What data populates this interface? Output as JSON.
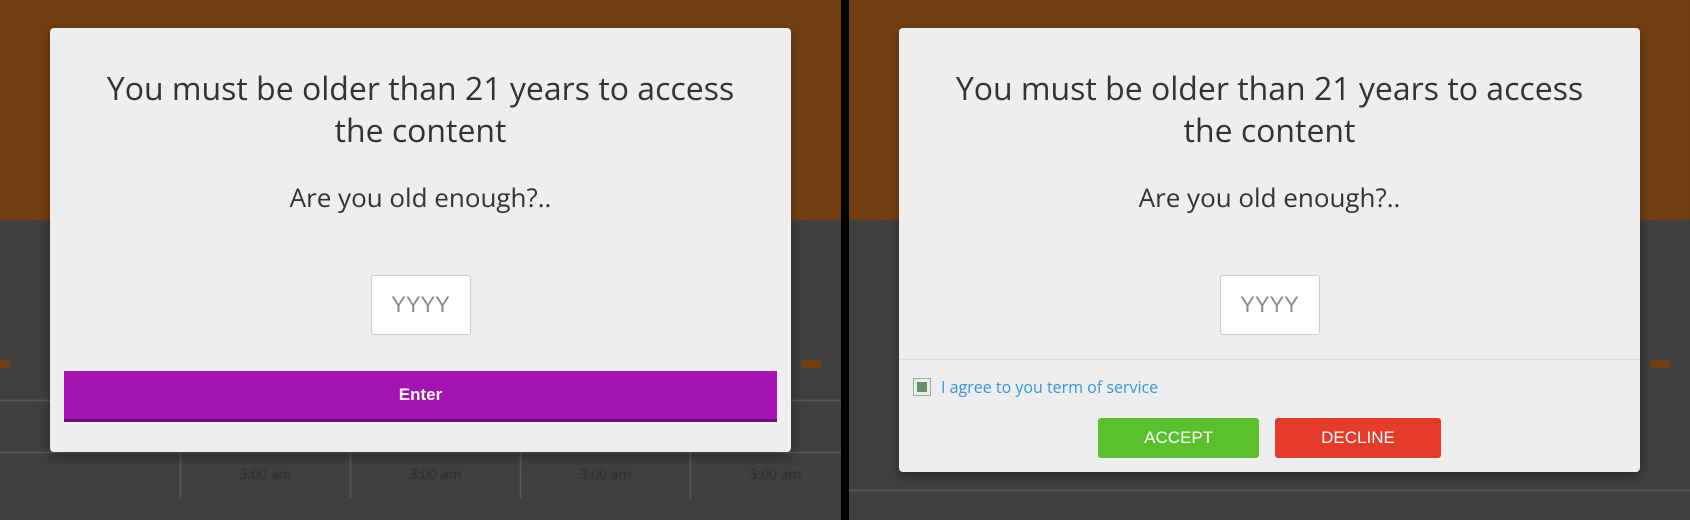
{
  "left": {
    "title": "You must be older than 21 years to access the content",
    "subtitle": "Are you old enough?..",
    "year_placeholder": "YYYY",
    "enter_label": "Enter",
    "bg": {
      "time1": "3:00 am",
      "time2": "3:00 am",
      "time3": "3:00 am",
      "time4": "3:00 am"
    }
  },
  "right": {
    "title": "You must be older than 21 years to access the content",
    "subtitle": "Are you old enough?..",
    "year_placeholder": "YYYY",
    "tos_label": "I agree to you term of service",
    "accept_label": "ACCEPT",
    "decline_label": "DECLINE"
  }
}
